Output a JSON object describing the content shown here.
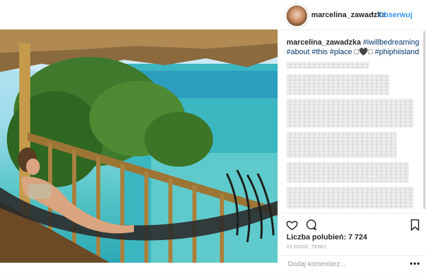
{
  "post": {
    "username": "marcelina_zawadzka",
    "separator": "•",
    "follow_label": "Obserwuj"
  },
  "caption": {
    "user": "marcelina_zawadzka",
    "tags_line1": "#iwillbedreaming",
    "tags_line2a": "#about #this #place",
    "emoji": "□🖤□",
    "tags_line2b": "#phiphiisland"
  },
  "stats": {
    "likes": "Liczba polubień: 7 724",
    "time": "20 GODZ. TEMU"
  },
  "comment": {
    "placeholder": "Dodaj komentarz...",
    "more": "•••"
  },
  "icons": {
    "like": "heart-icon",
    "comment": "comment-icon",
    "save": "bookmark-icon"
  },
  "colors": {
    "link": "#3897f0",
    "hashtag": "#003569"
  }
}
